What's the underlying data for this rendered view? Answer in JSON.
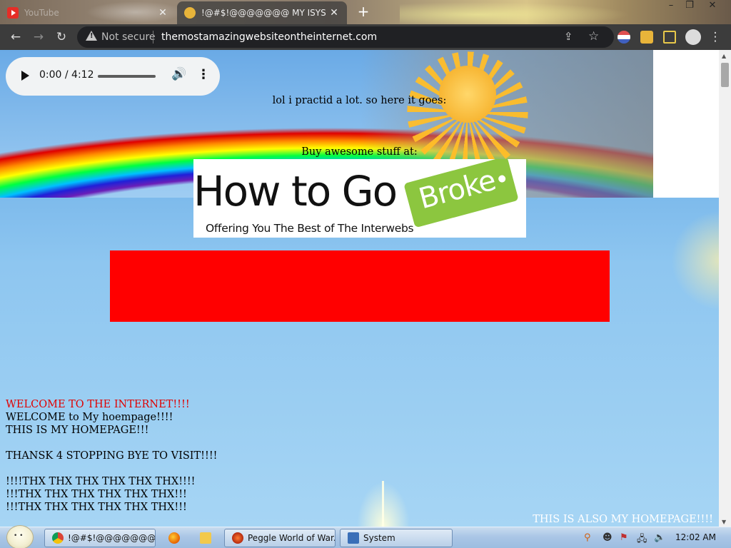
{
  "browser": {
    "tabs": [
      {
        "title": "YouTube",
        "active": false
      },
      {
        "title": "!@#$!@@@@@@@ MY ISYS PR",
        "active": true
      }
    ],
    "new_tab_label": "+",
    "security_label": "Not secure",
    "url": "themostamazingwebsiteontheinternet.com"
  },
  "page": {
    "audio": {
      "time": "0:00 / 4:12"
    },
    "intro_text": "lol i practid a lot. so here it goes:",
    "buy_text": "Buy awesome stuff at:",
    "banner": {
      "headline": "How to Go",
      "tag": "Broke",
      "tagline": "Offering You The Best of The Interwebs"
    },
    "lines": [
      {
        "text": "WELCOME TO THE INTERNET!!!!",
        "color": "#e00000"
      },
      {
        "text": "WELCOME to My hoempage!!!!",
        "color": "#000000"
      },
      {
        "text": "THIS IS MY HOMEPAGE!!!",
        "color": "#000000"
      },
      {
        "text": "THANSK 4 STOPPING BYE TO VISIT!!!!",
        "color": "#000000"
      },
      {
        "text": "!!!!THX THX THX THX THX THX!!!!",
        "color": "#000000"
      },
      {
        "text": "!!!THX THX THX THX THX THX!!!",
        "color": "#000000"
      },
      {
        "text": "!!!THX THX THX THX THX THX!!!",
        "color": "#000000"
      }
    ],
    "footer_text": "THIS IS ALSO MY HOMEPAGE!!!!"
  },
  "taskbar": {
    "items": [
      {
        "label": "!@#$!@@@@@@@ ..."
      },
      {
        "label": "Peggle World of War..."
      },
      {
        "label": "System"
      }
    ],
    "clock": "12:02 AM"
  },
  "colors": {
    "chrome_dark": "#3c3c3c",
    "omnibox": "#202124",
    "red_box": "#ff0000",
    "broke_tag": "#8cc63f"
  }
}
